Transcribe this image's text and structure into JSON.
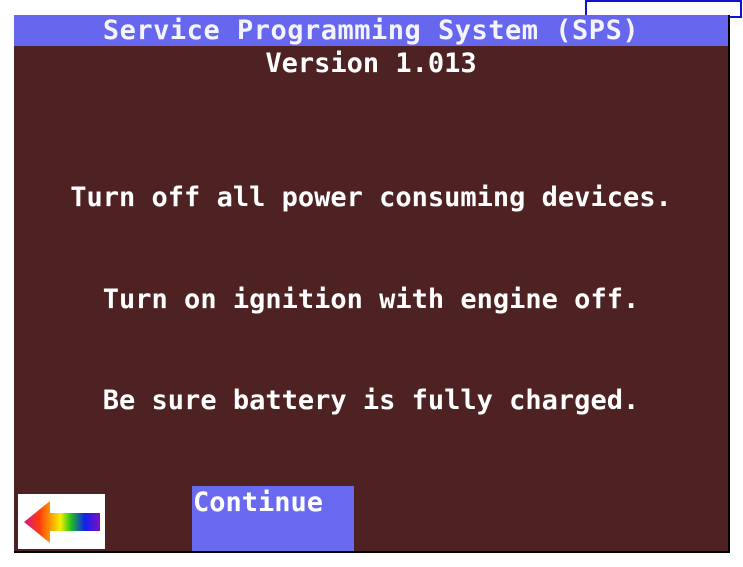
{
  "header": {
    "title": "Service Programming System (SPS)",
    "version": "Version 1.013"
  },
  "messages": [
    "Turn off all power consuming devices.",
    "Turn on ignition with engine off.",
    "Be sure battery is fully charged."
  ],
  "buttons": {
    "back_icon": "rainbow-left-arrow-icon",
    "continue_label": "Continue"
  },
  "colors": {
    "screen_bg": "#4e2222",
    "title_bg": "#6666ee",
    "button_bg": "#6a6af0",
    "text": "#ffffff"
  }
}
